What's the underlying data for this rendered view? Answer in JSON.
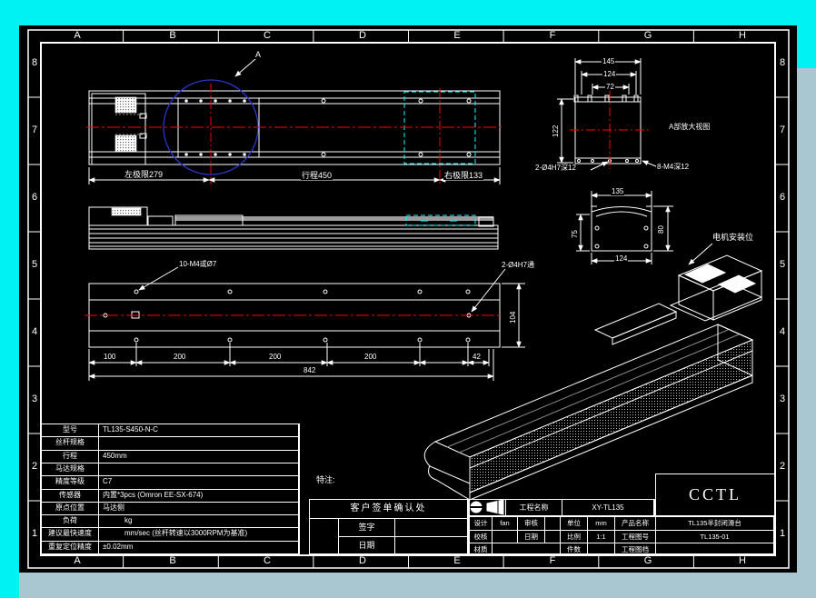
{
  "sheet": {
    "zone_columns": [
      "A",
      "B",
      "C",
      "D",
      "E",
      "F",
      "G",
      "H"
    ],
    "zone_rows": [
      "8",
      "7",
      "6",
      "5",
      "4",
      "3",
      "2",
      "1"
    ]
  },
  "top_view": {
    "detail_callout": "A",
    "dim_left_limit": "左极限279",
    "dim_stroke": "行程450",
    "dim_right_limit": "右极限133"
  },
  "bottom_view": {
    "label_holes": "10-M4或Ø7",
    "label_dowel": "2-Ø4H7通",
    "dims": [
      "100",
      "200",
      "200",
      "200",
      "42"
    ],
    "dim_total": "842",
    "dim_height": "104"
  },
  "detail_a": {
    "title": "A部放大视图",
    "dim_outer": "145",
    "dim_mid": "124",
    "dim_inner": "72",
    "dim_height": "122",
    "label_dowel": "2-Ø4H7深12",
    "label_tap": "8-M4深12"
  },
  "section_view": {
    "dim_top": "135",
    "dim_bottom": "124",
    "dim_left": "75",
    "dim_right": "80",
    "label_motor_mount": "电机安装位"
  },
  "spec_table": {
    "rows": [
      {
        "label": "型号",
        "value": "TL135-S450-N-C"
      },
      {
        "label": "丝杆规格",
        "value": ""
      },
      {
        "label": "行程",
        "value": "450mm"
      },
      {
        "label": "马达规格",
        "value": ""
      },
      {
        "label": "精度等级",
        "value": "C7"
      },
      {
        "label": "传感器",
        "value": "内置*3pcs (Omron EE-SX-674)"
      },
      {
        "label": "原点位置",
        "value": "马达侧"
      },
      {
        "label": "负荷",
        "value": "kg"
      },
      {
        "label": "建议最快速度",
        "value": "mm/sec (丝杆转速以3000RPM为基准)"
      },
      {
        "label": "重复定位精度",
        "value": "±0.02mm"
      }
    ]
  },
  "remark_label": "特注:",
  "signature_box": {
    "title": "客户签单确认处",
    "sign_label": "签字",
    "date_label": "日期"
  },
  "title_block": {
    "company": "CCTL",
    "project_label": "工程名称",
    "project_value": "XY-TL135",
    "design_label": "设计",
    "design_value": "fan",
    "review_label": "审核",
    "review_value": "",
    "check_label": "校核",
    "date_label": "日期",
    "material_label": "材质",
    "unit_label": "单位",
    "unit_value": "mm",
    "scale_label": "比例",
    "scale_value": "1:1",
    "qty_label": "件数",
    "qty_value": "",
    "product_label": "产品名称",
    "product_value": "TL135半封闭滑台",
    "dwgno_label": "工程图号",
    "dwgno_value": "TL135-01",
    "file_label": "工程图档",
    "file_value": ""
  },
  "colors": {
    "canvas_background": "#00f2f2",
    "paper": "#000000",
    "line": "#ffffff",
    "centerline": "#ff0000",
    "limit_highlight": "#00ffff",
    "detail_circle": "#2b35c8",
    "scrollbar": "#a9c7d0"
  }
}
